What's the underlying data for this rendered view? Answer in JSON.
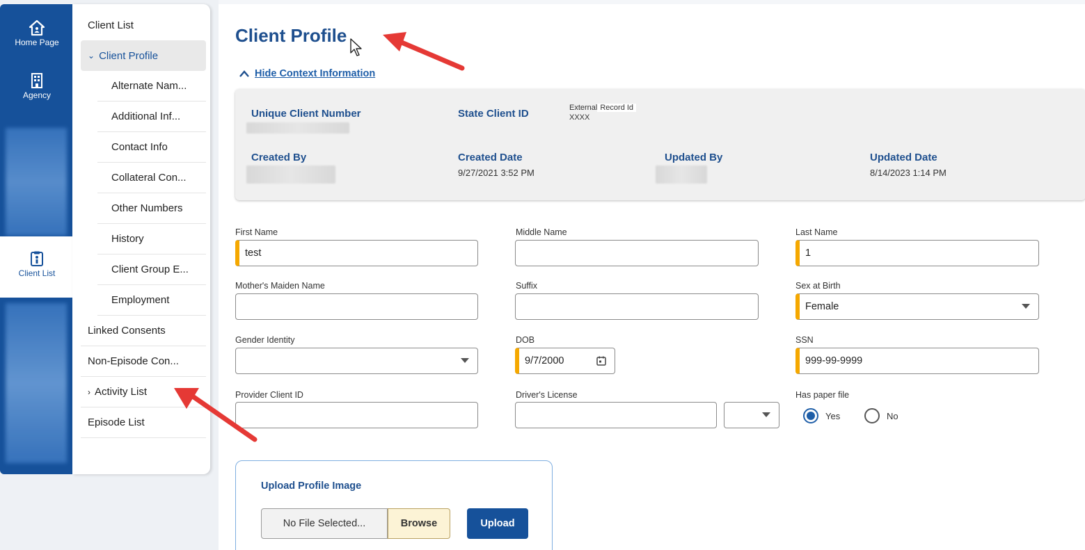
{
  "rail": {
    "items": [
      {
        "label": "Home Page",
        "icon": "home-icon"
      },
      {
        "label": "Agency",
        "icon": "building-icon"
      },
      {
        "label": "Client List",
        "icon": "clipboard-icon"
      }
    ]
  },
  "subnav": {
    "items": [
      {
        "label": "Client List"
      },
      {
        "label": "Client Profile",
        "expanded": true,
        "active": true
      },
      {
        "label": "Alternate Nam..."
      },
      {
        "label": "Additional Inf..."
      },
      {
        "label": "Contact Info"
      },
      {
        "label": "Collateral Con..."
      },
      {
        "label": "Other Numbers"
      },
      {
        "label": "History"
      },
      {
        "label": "Client Group E..."
      },
      {
        "label": "Employment"
      },
      {
        "label": "Linked Consents"
      },
      {
        "label": "Non-Episode Con..."
      },
      {
        "label": "Activity List",
        "collapsed": true
      },
      {
        "label": "Episode List"
      }
    ]
  },
  "page": {
    "title": "Client Profile",
    "hide_context": "Hide Context Information"
  },
  "context": {
    "unique_client_number_label": "Unique Client Number",
    "state_client_id_label": "State Client ID",
    "external_label": "External",
    "record_id_label": "Record Id",
    "record_id_value": "XXXX",
    "created_by_label": "Created By",
    "created_date_label": "Created Date",
    "created_date_value": "9/27/2021 3:52 PM",
    "updated_by_label": "Updated By",
    "updated_date_label": "Updated Date",
    "updated_date_value": "8/14/2023 1:14 PM"
  },
  "form": {
    "first_name": {
      "label": "First Name",
      "value": "test"
    },
    "middle_name": {
      "label": "Middle Name",
      "value": ""
    },
    "last_name": {
      "label": "Last Name",
      "value": "1"
    },
    "mothers_maiden_name": {
      "label": "Mother's Maiden Name",
      "value": ""
    },
    "suffix": {
      "label": "Suffix",
      "value": ""
    },
    "sex_at_birth": {
      "label": "Sex at Birth",
      "value": "Female"
    },
    "gender_identity": {
      "label": "Gender Identity",
      "value": ""
    },
    "dob": {
      "label": "DOB",
      "value": "9/7/2000"
    },
    "ssn": {
      "label": "SSN",
      "value": "999-99-9999"
    },
    "provider_client_id": {
      "label": "Provider Client ID",
      "value": ""
    },
    "drivers_license": {
      "label": "Driver's License",
      "value": "",
      "state": ""
    },
    "has_paper_file": {
      "label": "Has paper file",
      "options": [
        "Yes",
        "No"
      ],
      "selected": "Yes"
    }
  },
  "upload": {
    "title": "Upload Profile Image",
    "file_placeholder": "No File Selected...",
    "browse_label": "Browse",
    "upload_label": "Upload"
  },
  "colors": {
    "brand": "#16519a",
    "heading": "#1e4f8e",
    "required": "#f5a800",
    "annotation_arrow": "#e53935"
  }
}
